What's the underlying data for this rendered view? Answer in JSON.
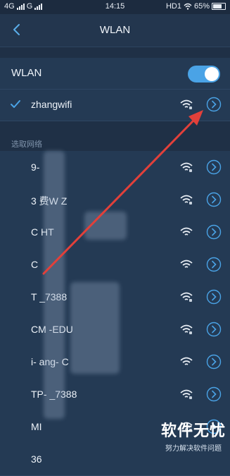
{
  "status": {
    "network_left": "4G",
    "carrier_left": "G",
    "time": "14:15",
    "hd_label": "HD1",
    "battery": "65%"
  },
  "header": {
    "title": "WLAN"
  },
  "wlan": {
    "label": "WLAN",
    "enabled": true
  },
  "connected": {
    "ssid": "zhangwifi"
  },
  "section": {
    "label": "选取网络"
  },
  "networks": [
    {
      "name": "9-"
    },
    {
      "name": "3 费W Z"
    },
    {
      "name": "C HT"
    },
    {
      "name": "C "
    },
    {
      "name": "T _7388"
    },
    {
      "name": "CM -EDU"
    },
    {
      "name": "i- ang- C"
    },
    {
      "name": "TP- _7388"
    },
    {
      "name": "MI"
    },
    {
      "name": "36"
    }
  ],
  "watermark": {
    "main": "软件无忧",
    "sub": "努力解决软件问题"
  },
  "colors": {
    "accent": "#4aa3e6",
    "arrow": "#e2403a"
  }
}
